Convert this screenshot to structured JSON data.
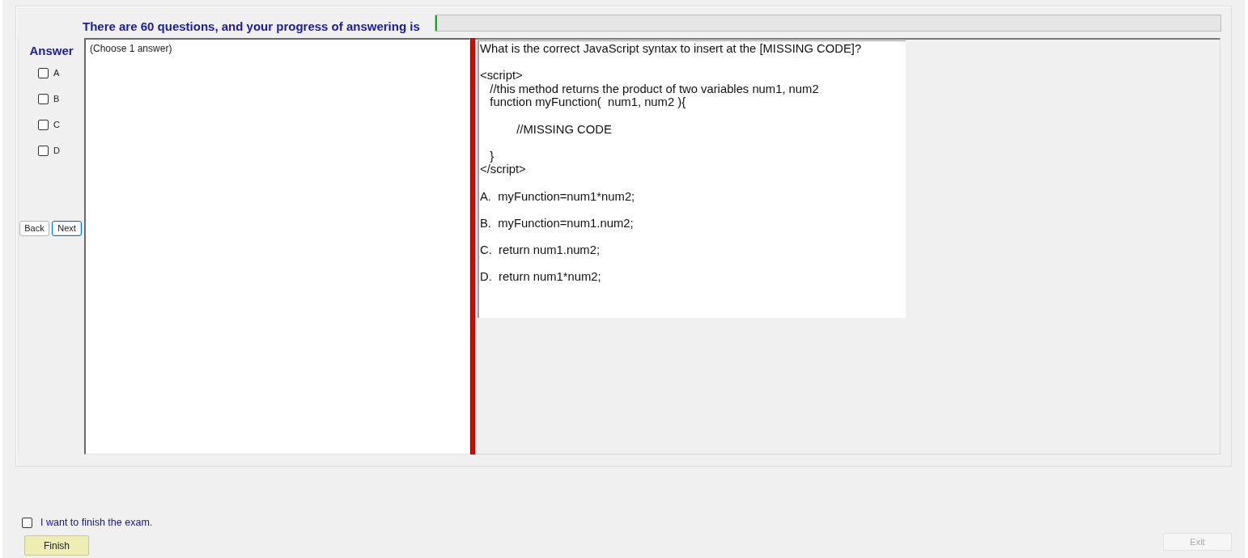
{
  "header": {
    "text": "There are 60 questions, and your progress of answering is",
    "progress": {
      "level": 0
    }
  },
  "answer_panel": {
    "title": "Answer",
    "options": [
      {
        "label": "A",
        "checked": false
      },
      {
        "label": "B",
        "checked": false
      },
      {
        "label": "C",
        "checked": false
      },
      {
        "label": "D",
        "checked": false
      }
    ],
    "buttons": [
      {
        "label": "Back",
        "focused": false
      },
      {
        "label": "Next",
        "focused": true
      }
    ]
  },
  "instruction": "(Choose 1 answer)",
  "question": {
    "prompt": "What is the correct JavaScript syntax to insert at the [MISSING CODE]?",
    "code": "<script>\n   //this method returns the product of two variables num1, num2\n   function myFunction(  num1, num2 ){\n\n           //MISSING CODE\n\n   }\n</script>",
    "options": [
      "A.  myFunction=num1*num2;",
      "B.  myFunction=num1.num2;",
      "C.  return num1.num2;",
      "D.  return num1*num2;"
    ]
  },
  "finish": {
    "label": "I want to finish the exam.",
    "checked": false,
    "button": {
      "label": "Finish",
      "disabled": false
    }
  },
  "exit_button": {
    "label": "Exit",
    "disabled": true
  }
}
